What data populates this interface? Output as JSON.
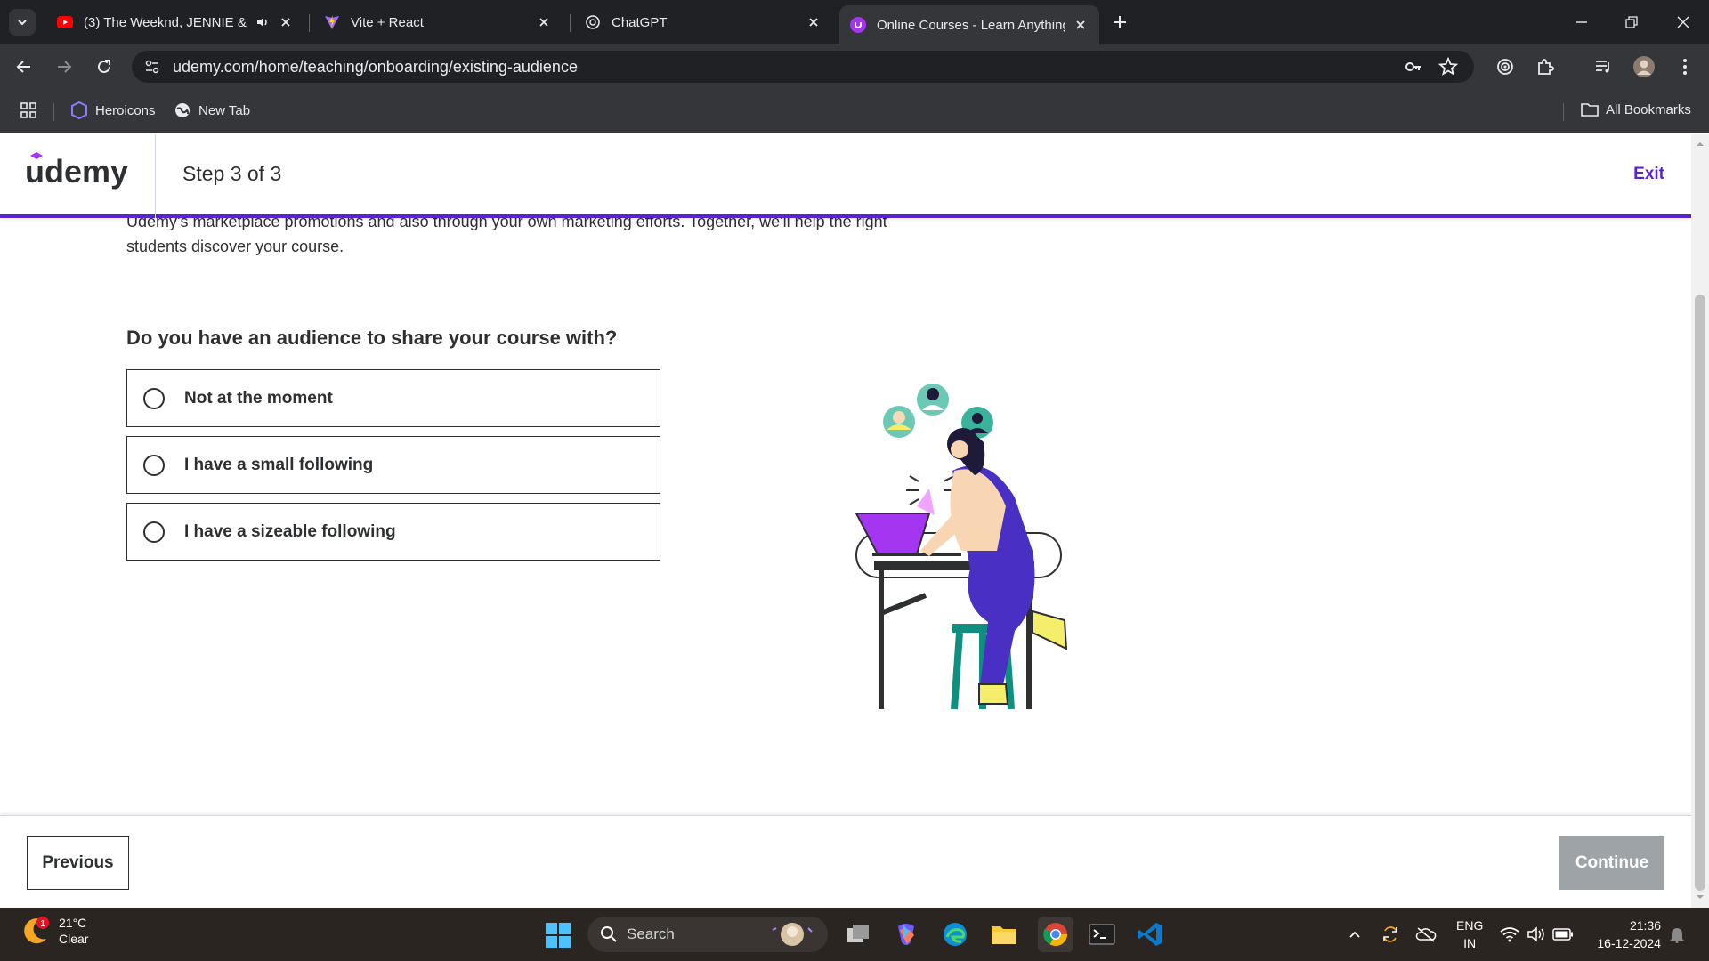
{
  "browser": {
    "tabs": [
      {
        "title": "(3) The Weeknd, JENNIE & l",
        "favicon": "youtube-icon",
        "audio": true
      },
      {
        "title": "Vite + React",
        "favicon": "vite-icon"
      },
      {
        "title": "ChatGPT",
        "favicon": "chatgpt-icon"
      },
      {
        "title": "Online Courses - Learn Anything",
        "favicon": "udemy-icon",
        "active": true
      }
    ],
    "url": "udemy.com/home/teaching/onboarding/existing-audience",
    "bookmarks": [
      {
        "label": "Heroicons",
        "icon": "heroicons-icon"
      },
      {
        "label": "New Tab",
        "icon": "globe-icon"
      }
    ],
    "all_bookmarks": "All Bookmarks"
  },
  "header": {
    "logo": "udemy",
    "step": "Step 3 of 3",
    "exit": "Exit"
  },
  "main": {
    "lead_line1": "Udemy's marketplace promotions and also through your own marketing efforts. Together, we'll help the right",
    "lead_line2": "students discover your course.",
    "question": "Do you have an audience to share your course with?",
    "options": [
      {
        "label": "Not at the moment",
        "selected": false
      },
      {
        "label": "I have a small following",
        "selected": false
      },
      {
        "label": "I have a sizeable following",
        "selected": false
      }
    ]
  },
  "footer": {
    "previous": "Previous",
    "continue": "Continue",
    "continue_disabled": true
  },
  "taskbar": {
    "weather_temp": "21°C",
    "weather_desc": "Clear",
    "notification_count": "1",
    "search": "Search",
    "lang1": "ENG",
    "lang2": "IN",
    "time": "21:36",
    "date": "16-12-2024"
  },
  "colors": {
    "brand": "#5624d0",
    "text": "#2d2f31",
    "disabled_button": "#9da3a7"
  }
}
